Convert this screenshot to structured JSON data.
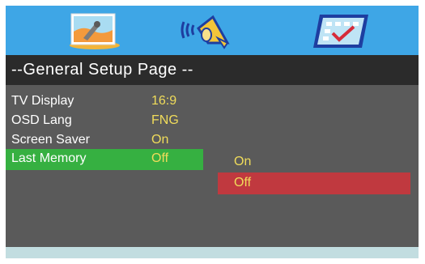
{
  "tabs": [
    {
      "icon": "general-setup-icon"
    },
    {
      "icon": "audio-setup-icon"
    },
    {
      "icon": "preference-setup-icon"
    }
  ],
  "page_title": "--General Setup Page --",
  "menu": [
    {
      "label": "TV Display",
      "value": "16:9"
    },
    {
      "label": "OSD Lang",
      "value": "FNG"
    },
    {
      "label": "Screen Saver",
      "value": "On"
    },
    {
      "label": "Last Memory",
      "value": "Off"
    }
  ],
  "options": [
    "On",
    "Off"
  ],
  "colors": {
    "topbar": "#3ea6e6",
    "selected_row": "#36b041",
    "highlight_option": "#c0393f",
    "value_text": "#f0dc5a"
  }
}
